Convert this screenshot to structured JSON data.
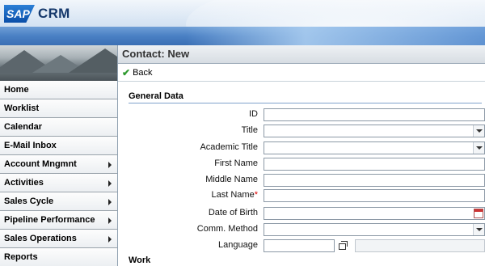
{
  "app": {
    "logo_text": "SAP",
    "name": "CRM"
  },
  "nav": {
    "items": [
      {
        "label": "Home",
        "has_submenu": false
      },
      {
        "label": "Worklist",
        "has_submenu": false
      },
      {
        "label": "Calendar",
        "has_submenu": false
      },
      {
        "label": "E-Mail Inbox",
        "has_submenu": false
      },
      {
        "label": "Account Mngmnt",
        "has_submenu": true
      },
      {
        "label": "Activities",
        "has_submenu": true
      },
      {
        "label": "Sales Cycle",
        "has_submenu": true
      },
      {
        "label": "Pipeline Performance",
        "has_submenu": true
      },
      {
        "label": "Sales Operations",
        "has_submenu": true
      },
      {
        "label": "Reports",
        "has_submenu": false
      }
    ]
  },
  "page": {
    "title": "Contact: New"
  },
  "toolbar": {
    "back_label": "Back"
  },
  "sections": {
    "general": "General Data",
    "work": "Work"
  },
  "form": {
    "id": {
      "label": "ID",
      "value": ""
    },
    "title": {
      "label": "Title",
      "value": ""
    },
    "academic_title": {
      "label": "Academic Title",
      "value": ""
    },
    "first_name": {
      "label": "First Name",
      "value": ""
    },
    "middle_name": {
      "label": "Middle Name",
      "value": ""
    },
    "last_name": {
      "label": "Last Name",
      "required_marker": "*",
      "value": ""
    },
    "date_of_birth": {
      "label": "Date of Birth",
      "value": ""
    },
    "comm_method": {
      "label": "Comm. Method",
      "value": ""
    },
    "language": {
      "label": "Language",
      "value": "",
      "description": ""
    }
  },
  "colors": {
    "header_bar": "#4a80c4",
    "section_rule": "#7fa2cc",
    "required": "#dd0000",
    "back_check": "#2f9a2f"
  }
}
